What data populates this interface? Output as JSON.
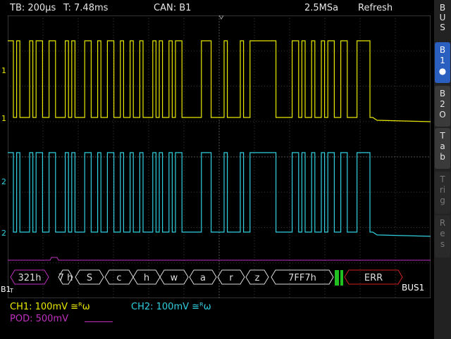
{
  "header": {
    "timebase": "TB: 200µs",
    "trigger_time": "T: 7.48ms",
    "bus": "CAN: B1",
    "sample_rate": "2.5MSa",
    "mode": "Refresh"
  },
  "sidebar": {
    "title": "BUS",
    "items": [
      {
        "label": "B1",
        "extra": "●",
        "active": true
      },
      {
        "label": "B2",
        "extra": "O",
        "active": false
      },
      {
        "label": "Tab",
        "extra": "",
        "active": false
      },
      {
        "label": "Trig",
        "extra": "",
        "active": false,
        "disabled": true
      },
      {
        "label": "Res",
        "extra": "",
        "active": false,
        "disabled": true
      }
    ]
  },
  "channels": {
    "ch1": {
      "label": "CH1: 100mV",
      "coupling": "≅ᴿω",
      "color": "#e8e800"
    },
    "ch2": {
      "label": "CH2: 100mV",
      "coupling": "≅ᴿω",
      "color": "#30d0e0"
    },
    "pod": {
      "label": "POD: 500mV",
      "color": "#c030c0"
    }
  },
  "markers": {
    "ch1_upper": "1",
    "ch1_lower": "1",
    "ch2_upper": "2",
    "ch2_lower": "2",
    "bus_marker": "B1",
    "trigger": "T",
    "bus_name": "BUS1"
  },
  "decode": {
    "frames": [
      {
        "text": "321h"
      },
      {
        "text": "7\nh"
      },
      {
        "text": "S"
      },
      {
        "text": "c"
      },
      {
        "text": "h"
      },
      {
        "text": "w"
      },
      {
        "text": "a"
      },
      {
        "text": "r"
      },
      {
        "text": "z"
      },
      {
        "text": "7FF7h"
      },
      {
        "text": "ERR"
      }
    ]
  },
  "colors": {
    "grid": "#3a3a3a",
    "ch1": "#e8e800",
    "ch2": "#30d0e0",
    "pod": "#c030c0",
    "error": "#d02020",
    "ack": "#20c020"
  }
}
